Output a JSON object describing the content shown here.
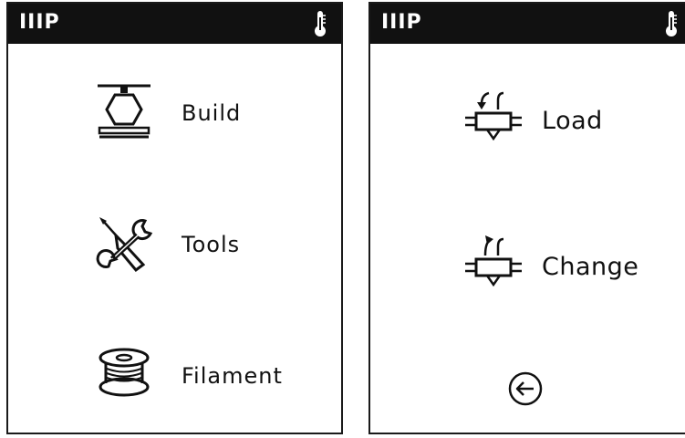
{
  "main_screen": {
    "title": "IIIP",
    "status_icon": "thermometer-icon",
    "items": [
      {
        "label": "Build",
        "icon": "build-icon"
      },
      {
        "label": "Tools",
        "icon": "tools-icon"
      },
      {
        "label": "Filament",
        "icon": "filament-spool-icon"
      }
    ]
  },
  "filament_screen": {
    "title": "IIIP",
    "status_icon": "thermometer-icon",
    "items": [
      {
        "label": "Load",
        "icon": "load-filament-icon"
      },
      {
        "label": "Change",
        "icon": "change-filament-icon"
      }
    ],
    "back_icon": "back-arrow-icon"
  },
  "colors": {
    "titlebar": "#111111",
    "background": "#ffffff",
    "foreground": "#111111"
  }
}
